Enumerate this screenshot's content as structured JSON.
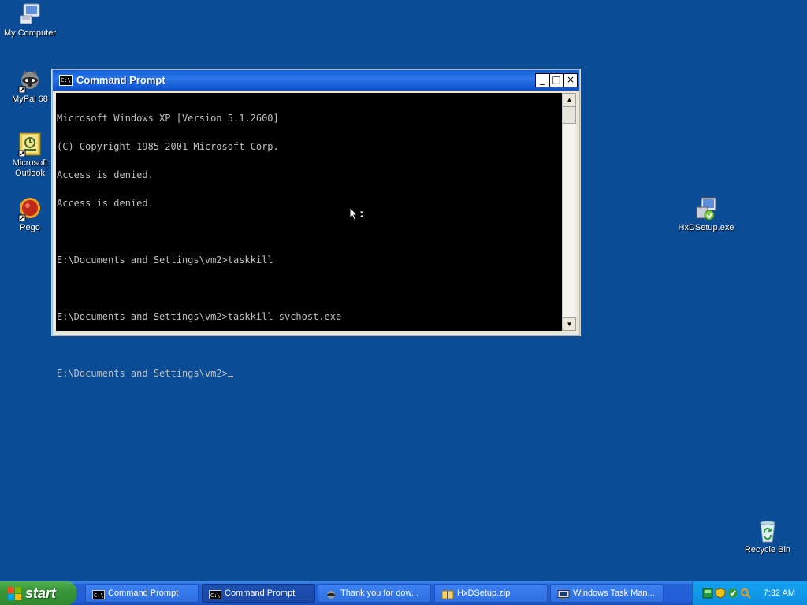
{
  "desktop": {
    "icons": [
      {
        "label": "My Computer"
      },
      {
        "label": "MyPal 68"
      },
      {
        "label": "Microsoft Outlook"
      },
      {
        "label": "Pego"
      },
      {
        "label": "HxDSetup.exe"
      },
      {
        "label": "Recycle Bin"
      }
    ]
  },
  "window": {
    "title": "Command Prompt",
    "buttons": {
      "minimize": "_",
      "maximize": "□",
      "close": "×"
    },
    "console_lines": [
      "Microsoft Windows XP [Version 5.1.2600]",
      "(C) Copyright 1985-2001 Microsoft Corp.",
      "Access is denied.",
      "Access is denied.",
      "",
      "E:\\Documents and Settings\\vm2>taskkill",
      "",
      "E:\\Documents and Settings\\vm2>taskkill svchost.exe",
      "",
      "E:\\Documents and Settings\\vm2>"
    ]
  },
  "taskbar": {
    "start_label": "start",
    "tasks": [
      {
        "label": "Command Prompt",
        "active": false
      },
      {
        "label": "Command Prompt",
        "active": true
      },
      {
        "label": "Thank you for dow...",
        "active": false
      },
      {
        "label": "HxDSetup.zip",
        "active": false
      },
      {
        "label": "Windows Task Man...",
        "active": false
      }
    ],
    "clock": "7:32 AM"
  },
  "colors": {
    "desktop": "#0a4c96",
    "taskbar": "#245edb",
    "start": "#3a963a",
    "console_bg": "#000000",
    "console_text": "#c0c0c0"
  }
}
